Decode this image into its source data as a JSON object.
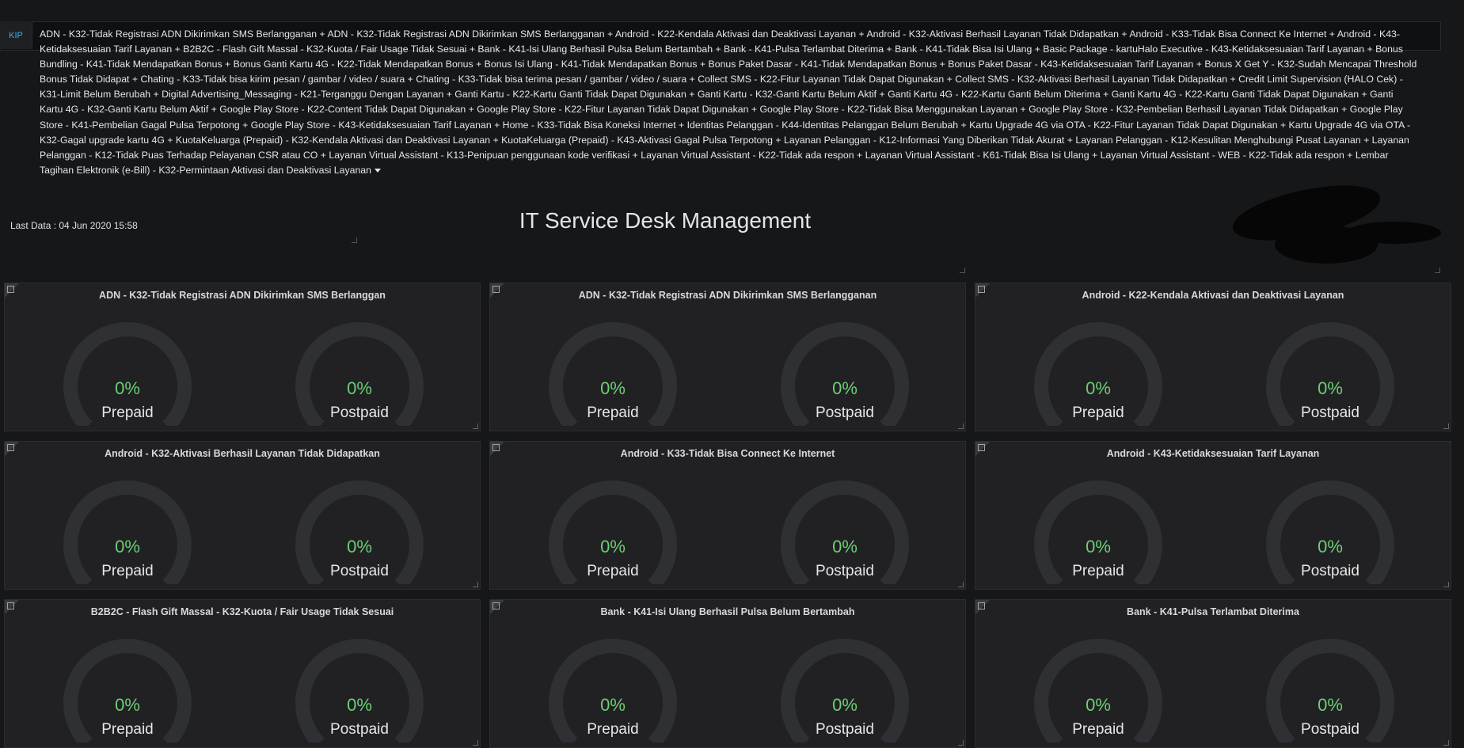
{
  "kip": {
    "label": "KIP",
    "text": "ADN - K32-Tidak Registrasi ADN Dikirimkan SMS Berlangganan + ADN - K32-Tidak Registrasi ADN Dikirimkan SMS Berlangganan + Android - K22-Kendala Aktivasi dan Deaktivasi Layanan + Android - K32-Aktivasi Berhasil Layanan Tidak Didapatkan + Android - K33-Tidak Bisa Connect Ke Internet + Android - K43-Ketidaksesuaian Tarif Layanan + B2B2C - Flash Gift Massal - K32-Kuota / Fair Usage Tidak Sesuai + Bank - K41-Isi Ulang Berhasil Pulsa Belum Bertambah + Bank - K41-Pulsa Terlambat Diterima + Bank - K41-Tidak Bisa Isi Ulang + Basic Package - kartuHalo Executive - K43-Ketidaksesuaian Tarif Layanan + Bonus Bundling - K41-Tidak Mendapatkan Bonus + Bonus Ganti Kartu 4G - K22-Tidak Mendapatkan Bonus + Bonus Isi Ulang - K41-Tidak Mendapatkan Bonus + Bonus Paket Dasar - K41-Tidak Mendapatkan Bonus + Bonus Paket Dasar - K43-Ketidaksesuaian Tarif Layanan + Bonus X Get Y - K32-Sudah Mencapai Threshold Bonus Tidak Didapat + Chating - K33-Tidak bisa kirim pesan / gambar / video / suara + Chating - K33-Tidak bisa terima pesan / gambar / video / suara + Collect SMS - K22-Fitur Layanan Tidak Dapat Digunakan + Collect SMS - K32-Aktivasi Berhasil Layanan Tidak Didapatkan + Credit Limit Supervision (HALO Cek) - K31-Limit Belum Berubah + Digital Advertising_Messaging - K21-Terganggu Dengan Layanan + Ganti Kartu - K22-Kartu Ganti Tidak Dapat Digunakan + Ganti Kartu - K32-Ganti Kartu Belum Aktif + Ganti Kartu 4G - K22-Kartu Ganti Belum Diterima + Ganti Kartu 4G - K22-Kartu Ganti Tidak Dapat Digunakan + Ganti Kartu 4G - K32-Ganti Kartu Belum Aktif + Google Play Store - K22-Content Tidak Dapat Digunakan + Google Play Store - K22-Fitur Layanan Tidak Dapat Digunakan + Google Play Store - K22-Tidak Bisa Menggunakan Layanan + Google Play Store - K32-Pembelian Berhasil Layanan Tidak Didapatkan + Google Play Store - K41-Pembelian Gagal Pulsa Terpotong + Google Play Store - K43-Ketidaksesuaian Tarif Layanan + Home - K33-Tidak Bisa Koneksi Internet + Identitas Pelanggan - K44-Identitas Pelanggan Belum Berubah + Kartu Upgrade 4G via OTA - K22-Fitur Layanan Tidak Dapat Digunakan + Kartu Upgrade 4G via OTA - K32-Gagal upgrade kartu 4G + KuotaKeluarga (Prepaid) - K32-Kendala Aktivasi dan Deaktivasi Layanan + KuotaKeluarga (Prepaid) - K43-Aktivasi Gagal Pulsa Terpotong + Layanan Pelanggan - K12-Informasi Yang Diberikan Tidak Akurat + Layanan Pelanggan - K12-Kesulitan Menghubungi Pusat Layanan + Layanan Pelanggan - K12-Tidak Puas Terhadap Pelayanan CSR atau CO + Layanan Virtual Assistant - K13-Penipuan penggunaan kode verifikasi + Layanan Virtual Assistant - K22-Tidak ada respon + Layanan Virtual Assistant - K61-Tidak Bisa Isi Ulang + Layanan Virtual Assistant - WEB - K22-Tidak ada respon + Lembar Tagihan Elektronik (e-Bill) - K32-Permintaan Aktivasi dan Deaktivasi Layanan"
  },
  "header": {
    "last_data": "Last Data : 04 Jun 2020 15:58",
    "title": "IT Service Desk Management"
  },
  "panels": [
    {
      "title": "ADN - K32-Tidak Registrasi ADN Dikirimkan SMS Berlanggan",
      "prepaid": "0%",
      "postpaid": "0%"
    },
    {
      "title": "ADN - K32-Tidak Registrasi ADN Dikirimkan SMS Berlangganan",
      "prepaid": "0%",
      "postpaid": "0%"
    },
    {
      "title": "Android - K22-Kendala Aktivasi dan Deaktivasi Layanan",
      "prepaid": "0%",
      "postpaid": "0%"
    },
    {
      "title": "Android - K32-Aktivasi Berhasil Layanan Tidak Didapatkan",
      "prepaid": "0%",
      "postpaid": "0%"
    },
    {
      "title": "Android - K33-Tidak Bisa Connect Ke Internet",
      "prepaid": "0%",
      "postpaid": "0%"
    },
    {
      "title": "Android - K43-Ketidaksesuaian Tarif Layanan",
      "prepaid": "0%",
      "postpaid": "0%"
    },
    {
      "title": "B2B2C - Flash Gift Massal - K32-Kuota / Fair Usage Tidak Sesuai",
      "prepaid": "0%",
      "postpaid": "0%"
    },
    {
      "title": "Bank - K41-Isi Ulang Berhasil Pulsa Belum Bertambah",
      "prepaid": "0%",
      "postpaid": "0%"
    },
    {
      "title": "Bank - K41-Pulsa Terlambat Diterima",
      "prepaid": "0%",
      "postpaid": "0%"
    }
  ],
  "gauge_labels": {
    "prepaid": "Prepaid",
    "postpaid": "Postpaid"
  },
  "colors": {
    "value": "#6ccf73",
    "track": "#2f3033",
    "background": "#161719",
    "panel": "#212124"
  }
}
